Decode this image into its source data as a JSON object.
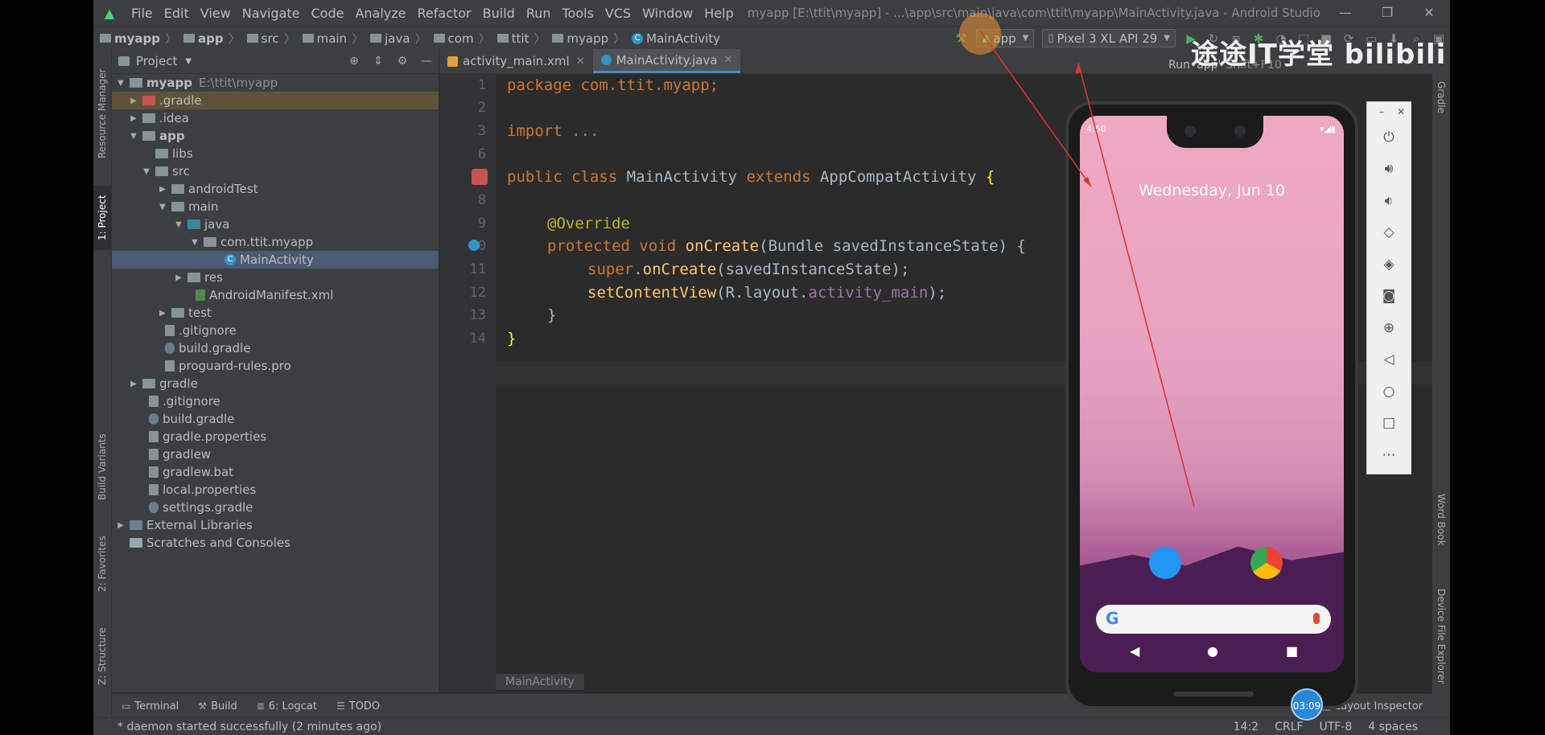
{
  "menu": {
    "items": [
      "File",
      "Edit",
      "View",
      "Navigate",
      "Code",
      "Analyze",
      "Refactor",
      "Build",
      "Run",
      "Tools",
      "VCS",
      "Window",
      "Help"
    ],
    "title": "myapp [E:\\ttit\\myapp] - ...\\app\\src\\main\\java\\com\\ttit\\myapp\\MainActivity.java - Android Studio"
  },
  "breadcrumb": [
    "myapp",
    "app",
    "src",
    "main",
    "java",
    "com",
    "ttit",
    "myapp",
    "MainActivity"
  ],
  "toolbar": {
    "run_config": "app",
    "device": "Pixel 3 XL API 29",
    "tooltip": "Run 'app'",
    "tooltip_shortcut": "Shift+F10"
  },
  "left_strip": [
    "Resource Manager",
    "1: Project",
    "Build Variants",
    "2: Favorites",
    "Z: Structure"
  ],
  "right_strip": [
    "Gradle",
    "Word Book",
    "Device File Explorer"
  ],
  "project": {
    "header": "Project",
    "root_name": "myapp",
    "root_path": "E:\\ttit\\myapp",
    "tree": [
      ".gradle",
      ".idea",
      "app",
      "libs",
      "src",
      "androidTest",
      "main",
      "java",
      "com.ttit.myapp",
      "MainActivity",
      "res",
      "AndroidManifest.xml",
      "test",
      ".gitignore",
      "build.gradle",
      "proguard-rules.pro",
      "gradle",
      ".gitignore",
      "build.gradle",
      "gradle.properties",
      "gradlew",
      "gradlew.bat",
      "local.properties",
      "settings.gradle",
      "External Libraries",
      "Scratches and Consoles"
    ]
  },
  "tabs": [
    "activity_main.xml",
    "MainActivity.java"
  ],
  "line_numbers": [
    "1",
    "2",
    "3",
    "6",
    "7",
    "8",
    "9",
    "10",
    "11",
    "12",
    "13",
    "14"
  ],
  "code": {
    "l1": "package com.ttit.myapp;",
    "l3a": "import",
    "l3b": " ...",
    "l7": [
      "public class",
      " MainActivity ",
      "extends",
      " AppCompatActivity ",
      "{"
    ],
    "l9": "@Override",
    "l10": [
      "protected void",
      " ",
      "onCreate",
      "(Bundle savedInstanceState) ",
      "{"
    ],
    "l11": [
      "super",
      ".",
      "onCreate",
      "(savedInstanceState);"
    ],
    "l12": [
      "setContentView",
      "(R.layout.",
      "activity_main",
      ");"
    ],
    "l13": "}",
    "l14": "}"
  },
  "editor_breadcrumb": "MainActivity",
  "bottom_tools": [
    "Terminal",
    "Build",
    "6: Logcat",
    "TODO"
  ],
  "bottom_tools_right": [
    "Event Log",
    "Layout Inspector"
  ],
  "status": {
    "message": "* daemon started successfully (2 minutes ago)",
    "position": "14:2",
    "line_sep": "CRLF",
    "encoding": "UTF-8",
    "indent": "4 spaces"
  },
  "watermark": "途途IT学堂 bilibili",
  "phone": {
    "time": "4:50",
    "date": "Wednesday, Jun 10",
    "search_logo": "G"
  },
  "timer": "03:09",
  "colors": {
    "accent": "#4a88c7",
    "android_green": "#3ddc84",
    "keyword": "#cc7832",
    "function": "#ffc66d"
  }
}
